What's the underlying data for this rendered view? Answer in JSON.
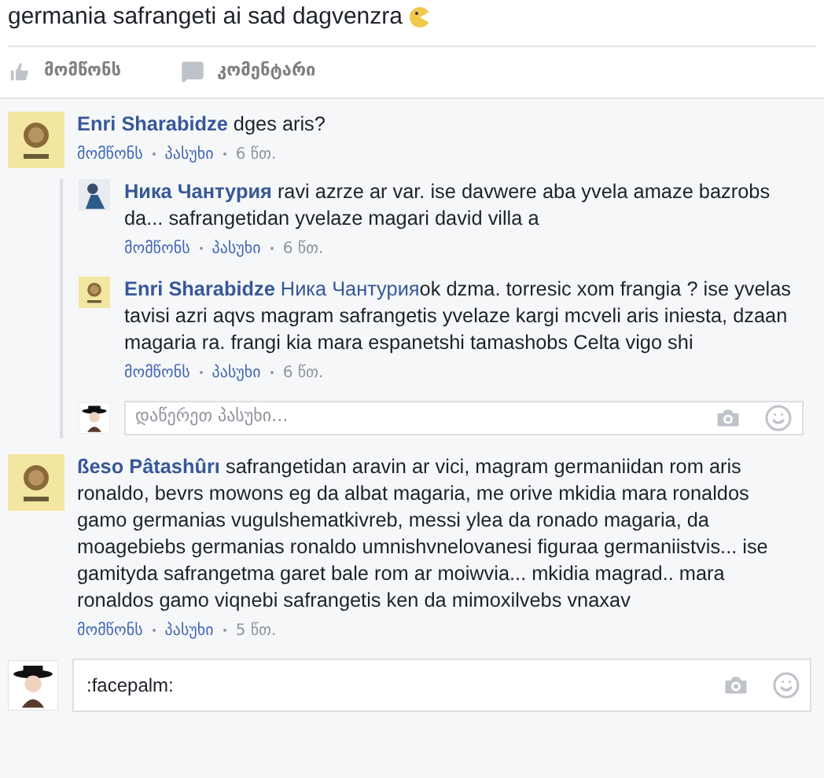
{
  "post": {
    "text": "germania safrangeti ai sad dagvenzra"
  },
  "actions": [
    {
      "kind": "like",
      "label": "მომწონს"
    },
    {
      "kind": "comment",
      "label": "კომენტარი"
    }
  ],
  "comments": [
    {
      "author": "Enri Sharabidze",
      "kind": "lion",
      "text": "dges aris?",
      "meta": [
        "მომწონს",
        "პასუხი",
        "6 წთ."
      ],
      "replies": [
        {
          "author": "Ника Чантурия",
          "kind": "person",
          "text": "ravi azrze ar var. ise davwere aba yvela amaze bazrobs da... safrangetidan yvelaze magari david villa a",
          "meta": [
            "მომწონს",
            "პასუხი",
            "6 წთ."
          ]
        },
        {
          "author": "Enri Sharabidze",
          "kind": "lion",
          "mention": "Ника Чантурия",
          "text": "ok dzma. torresic xom frangia ? ise yvelas tavisi azri aqvs magram safrangetis yvelaze kargi mcveli aris iniesta, dzaan magaria ra. frangi kia mara espanetshi tamashobs Celta vigo shi",
          "meta": [
            "მომწონს",
            "პასუხი",
            "6 წთ."
          ]
        }
      ],
      "reply_box": {
        "placeholder": "დაწერეთ პასუხი..."
      }
    },
    {
      "author": "ßeso Pâtashûrı",
      "kind": "lion",
      "text": "safrangetidan aravin ar vici, magram germaniidan rom aris ronaldo, bevrs mowons eg da albat magaria, me orive mkidia mara ronaldos gamo germanias vugulshematkivreb, messi ylea da ronado magaria, da moagebiebs germanias ronaldo umnishvnelovanesi figuraa germaniistvis... ise gamityda safrangetma garet bale rom ar moiwvia... mkidia magrad.. mara ronaldos gamo viqnebi safrangetis ken da mimoxilvebs vnaxav",
      "meta": [
        "მომწონს",
        "პასუხი",
        "5 წთ."
      ]
    }
  ],
  "comment_box": {
    "value": ":facepalm:"
  }
}
